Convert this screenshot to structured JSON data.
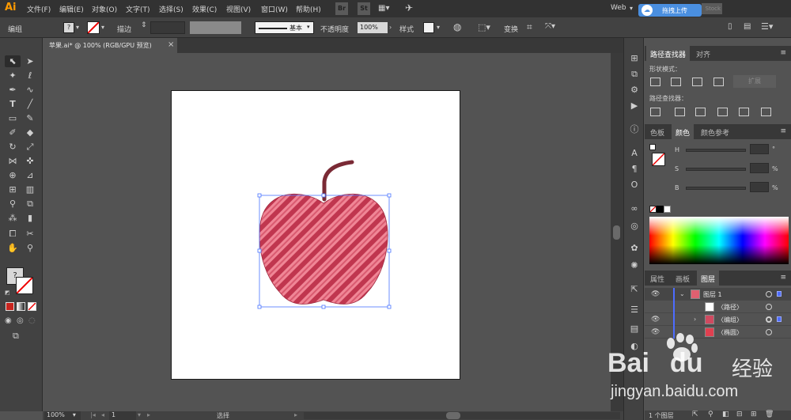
{
  "menubar": {
    "logo": "Ai",
    "menus": [
      "文件(F)",
      "编辑(E)",
      "对象(O)",
      "文字(T)",
      "选择(S)",
      "效果(C)",
      "视图(V)",
      "窗口(W)",
      "帮助(H)"
    ],
    "bridge_label": "Br",
    "stock_label": "St",
    "workspace": "Web",
    "upload_label": "拖拽上传",
    "search_stock": "Stock"
  },
  "control": {
    "selection_type": "编组",
    "stroke_label": "描边",
    "stroke_profile": "基本",
    "opacity_label": "不透明度",
    "opacity_value": "100%",
    "style_label": "样式",
    "transform_label": "变换",
    "fill_unknown": "?"
  },
  "document": {
    "tab_title": "苹果.ai* @ 100% (RGB/GPU 预览)",
    "close_glyph": "×"
  },
  "status": {
    "zoom": "100%",
    "artboard_num": "1",
    "status_text": "选择"
  },
  "pathfinder": {
    "tabs": [
      "路径查找器",
      "对齐"
    ],
    "shape_modes_label": "形状模式：",
    "expand_label": "扩展",
    "pathfinders_label": "路径查找器："
  },
  "color": {
    "tabs": [
      "色板",
      "颜色",
      "颜色参考"
    ],
    "h_label": "H",
    "h_unit": "°",
    "s_label": "S",
    "s_unit": "%",
    "b_label": "B",
    "b_unit": "%"
  },
  "layers": {
    "tabs": [
      "属性",
      "画板",
      "图层"
    ],
    "rows": [
      {
        "name": "图层 1"
      },
      {
        "name": "〈路径〉"
      },
      {
        "name": "〈编组〉"
      },
      {
        "name": "〈椭圆〉"
      }
    ],
    "footer": "1 个图层"
  },
  "watermark": {
    "brand": "Bai",
    "brand2": "du",
    "cn": "经验",
    "url": "jingyan.baidu.com"
  },
  "colors": {
    "accent_layer": "#4d6cff",
    "apple_dark": "#c0364f",
    "apple_light": "#f08696",
    "stem": "#7a2a35",
    "selection": "#4a74ff"
  }
}
